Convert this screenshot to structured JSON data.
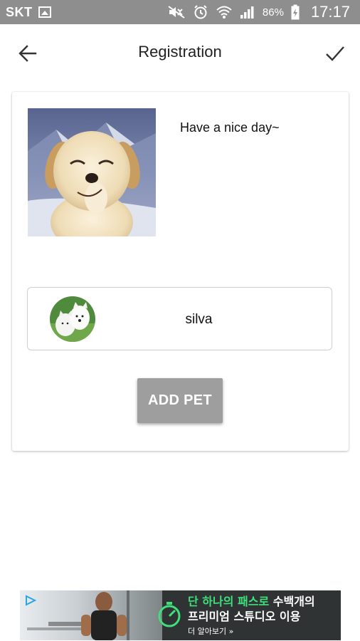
{
  "status_bar": {
    "carrier": "SKT",
    "battery_text": "86%",
    "time": "17:17",
    "icons": [
      "gallery-icon",
      "mute-icon",
      "alarm-icon",
      "wifi-icon",
      "signal-icon",
      "battery-icon"
    ]
  },
  "toolbar": {
    "title": "Registration",
    "back_icon": "arrow-back-icon",
    "confirm_icon": "check-icon"
  },
  "profile": {
    "greeting": "Have a nice day~",
    "photo": "puppy-photo"
  },
  "pets": [
    {
      "name": "silva",
      "avatar": "white-dog-avatar"
    }
  ],
  "actions": {
    "add_pet_label": "ADD PET"
  },
  "ad": {
    "line1_highlight": "단 하나의 패스로",
    "line1_rest": " 수백개의",
    "line2": "프리미엄 스튜디오 이용",
    "more": "더 알아보기 »",
    "accent": "#3fe07c"
  },
  "colors": {
    "status_bar": "#8e8e8e",
    "button": "#9e9e9e"
  }
}
